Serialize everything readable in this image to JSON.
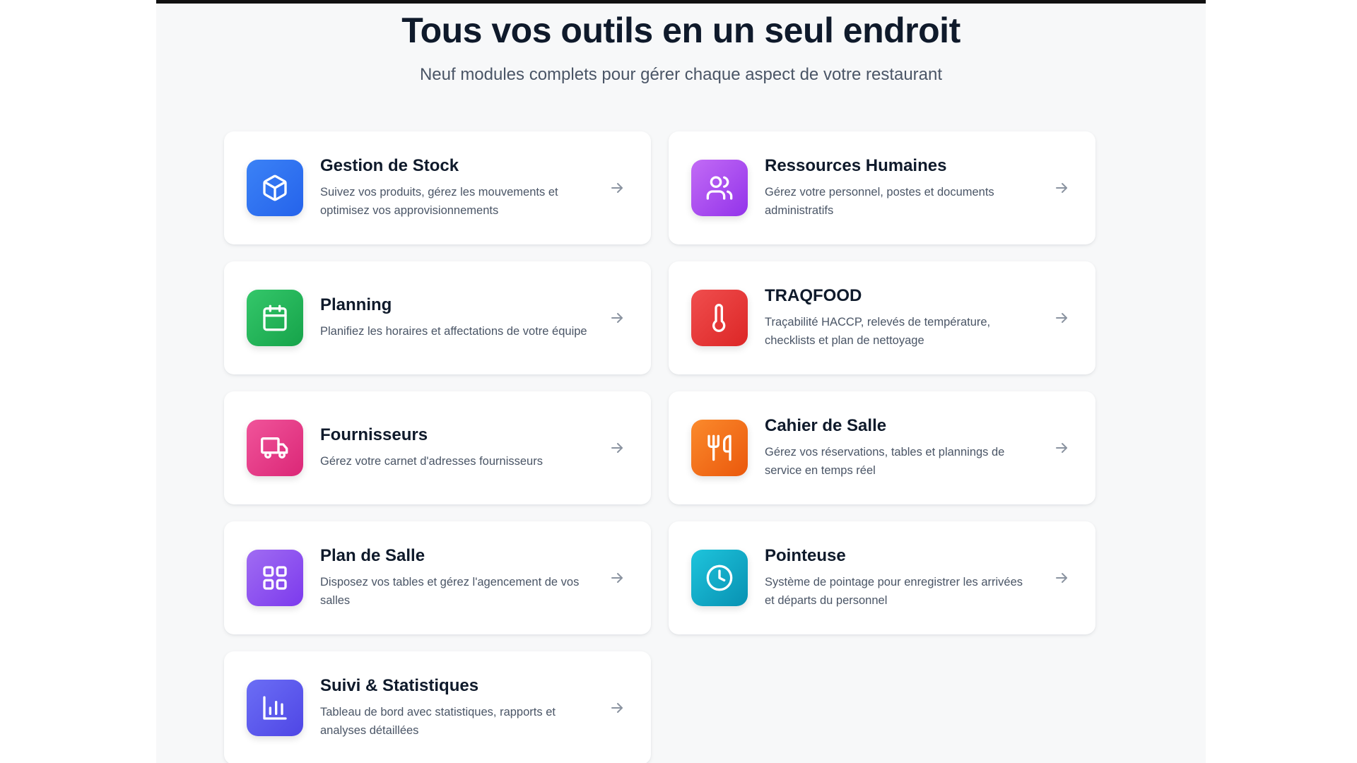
{
  "header": {
    "title": "Tous vos outils en un seul endroit",
    "subtitle": "Neuf modules complets pour gérer chaque aspect de votre restaurant"
  },
  "modules": [
    {
      "title": "Gestion de Stock",
      "description": "Suivez vos produits, gérez les mouvements et optimisez vos approvisionnements",
      "icon": "box-icon",
      "color_from": "#3b82f6",
      "color_to": "#2563eb"
    },
    {
      "title": "Ressources Humaines",
      "description": "Gérez votre personnel, postes et documents administratifs",
      "icon": "users-icon",
      "color_from": "#c26bf5",
      "color_to": "#9333ea"
    },
    {
      "title": "Planning",
      "description": "Planifiez les horaires et affectations de votre équipe",
      "icon": "calendar-icon",
      "color_from": "#34c76a",
      "color_to": "#16a34a"
    },
    {
      "title": "TRAQFOOD",
      "description": "Traçabilité HACCP, relevés de température, checklists et plan de nettoyage",
      "icon": "thermometer-icon",
      "color_from": "#f04e4e",
      "color_to": "#dc2626"
    },
    {
      "title": "Fournisseurs",
      "description": "Gérez votre carnet d'adresses fournisseurs",
      "icon": "truck-icon",
      "color_from": "#f0549a",
      "color_to": "#db2777"
    },
    {
      "title": "Cahier de Salle",
      "description": "Gérez vos réservations, tables et plannings de service en temps réel",
      "icon": "utensils-icon",
      "color_from": "#fb8a2c",
      "color_to": "#ea580c"
    },
    {
      "title": "Plan de Salle",
      "description": "Disposez vos tables et gérez l'agencement de vos salles",
      "icon": "grid-icon",
      "color_from": "#a06cf2",
      "color_to": "#7c3aed"
    },
    {
      "title": "Pointeuse",
      "description": "Système de pointage pour enregistrer les arrivées et départs du personnel",
      "icon": "clock-icon",
      "color_from": "#1ec4dc",
      "color_to": "#0891b2"
    },
    {
      "title": "Suivi & Statistiques",
      "description": "Tableau de bord avec statistiques, rapports et analyses détaillées",
      "icon": "bar-chart-icon",
      "color_from": "#6b6ef5",
      "color_to": "#4f46e5"
    }
  ]
}
